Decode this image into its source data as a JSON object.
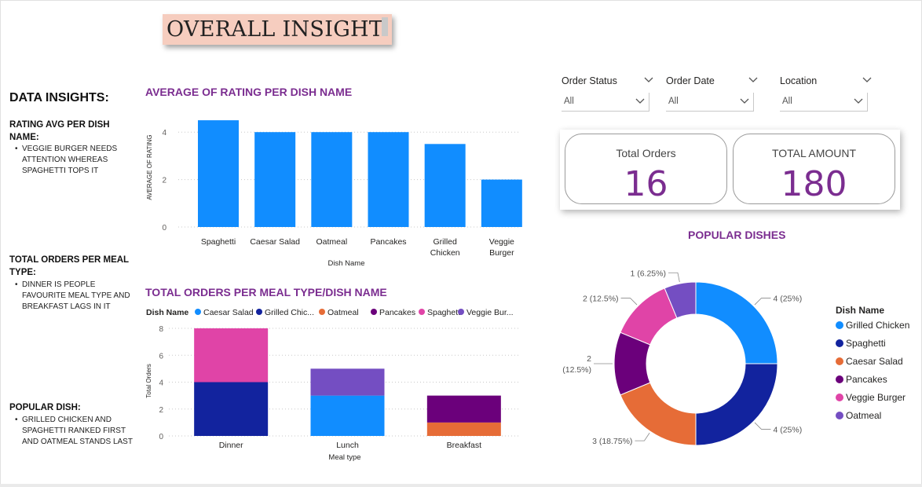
{
  "report": {
    "title": "OVERALL INSIGHT"
  },
  "insights": {
    "heading": "DATA INSIGHTS:",
    "items": [
      {
        "title": "RATING AVG PER DISH NAME:",
        "text": "VEGGIE BURGER NEEDS ATTENTION WHEREAS SPAGHETTI TOPS IT"
      },
      {
        "title": "TOTAL ORDERS PER MEAL TYPE:",
        "text": "DINNER IS PEOPLE FAVOURITE MEAL TYPE AND BREAKFAST LAGS IN IT"
      },
      {
        "title": "POPULAR DISH:",
        "text": "GRILLED CHICKEN AND SPAGHETTI RANKED FIRST AND OATMEAL STANDS LAST"
      }
    ]
  },
  "slicers": [
    {
      "label": "Order Status",
      "value": "All"
    },
    {
      "label": "Order Date",
      "value": "All"
    },
    {
      "label": "Location",
      "value": "All"
    }
  ],
  "kpis": [
    {
      "label": "Total Orders",
      "value": "16"
    },
    {
      "label": "TOTAL AMOUNT",
      "value": "180"
    }
  ],
  "colors": {
    "title_bg": "#f6cdbf",
    "title_text": "#7b2d90",
    "bar_blue": "#118dff",
    "caesar_salad": "#118dff",
    "grilled_chicken": "#12239e",
    "oatmeal": "#e66c37",
    "pancakes": "#6b007b",
    "spaghetti": "#e044a7",
    "veggie_burger": "#744ec2"
  },
  "chart_data": [
    {
      "type": "bar",
      "title": "AVERAGE OF RATING PER DISH NAME",
      "categories": [
        "Spaghetti",
        "Caesar Salad",
        "Oatmeal",
        "Pancakes",
        "Grilled Chicken",
        "Veggie Burger"
      ],
      "values": [
        4.5,
        4.0,
        4.0,
        4.0,
        3.5,
        2.0
      ],
      "xlabel": "Dish Name",
      "ylabel": "AVERAGE OF RATING",
      "yticks": [
        "0",
        "2",
        "4"
      ],
      "ylim": [
        0,
        5
      ],
      "grid": true
    },
    {
      "type": "bar",
      "stacked": true,
      "title": "TOTAL ORDERS PER MEAL TYPE/DISH NAME",
      "legend_title": "Dish Name",
      "legend_labels": [
        "Caesar Salad",
        "Grilled Chic...",
        "Oatmeal",
        "Pancakes",
        "Spaghetti",
        "Veggie Bur..."
      ],
      "categories": [
        "Dinner",
        "Lunch",
        "Breakfast"
      ],
      "series": [
        {
          "name": "Caesar Salad",
          "color": "#118dff",
          "values": [
            0,
            3,
            0
          ]
        },
        {
          "name": "Grilled Chicken",
          "color": "#12239e",
          "values": [
            4,
            0,
            0
          ]
        },
        {
          "name": "Oatmeal",
          "color": "#e66c37",
          "values": [
            0,
            0,
            1
          ]
        },
        {
          "name": "Pancakes",
          "color": "#6b007b",
          "values": [
            0,
            0,
            2
          ]
        },
        {
          "name": "Spaghetti",
          "color": "#e044a7",
          "values": [
            4,
            0,
            0
          ]
        },
        {
          "name": "Veggie Burger",
          "color": "#744ec2",
          "values": [
            0,
            2,
            0
          ]
        }
      ],
      "xlabel": "Meal type",
      "ylabel": "Total Orders",
      "yticks": [
        "0",
        "2",
        "4",
        "6",
        "8"
      ],
      "ylim": [
        0,
        8
      ],
      "grid": true
    },
    {
      "type": "pie",
      "donut": true,
      "title": "POPULAR DISHES",
      "legend_title": "Dish Name",
      "legend_placement": "right",
      "slices": [
        {
          "name": "Grilled Chicken",
          "value": 4,
          "label": "4 (25%)",
          "color": "#118dff"
        },
        {
          "name": "Spaghetti",
          "value": 4,
          "label": "4 (25%)",
          "color": "#12239e"
        },
        {
          "name": "Caesar Salad",
          "value": 3,
          "label": "3 (18.75%)",
          "color": "#e66c37"
        },
        {
          "name": "Pancakes",
          "value": 2,
          "label": "2 (12.5%)",
          "color": "#6b007b"
        },
        {
          "name": "Veggie Burger",
          "value": 2,
          "label": "2 (12.5%)",
          "color": "#e044a7"
        },
        {
          "name": "Oatmeal",
          "value": 1,
          "label": "1 (6.25%)",
          "color": "#744ec2"
        }
      ]
    }
  ]
}
